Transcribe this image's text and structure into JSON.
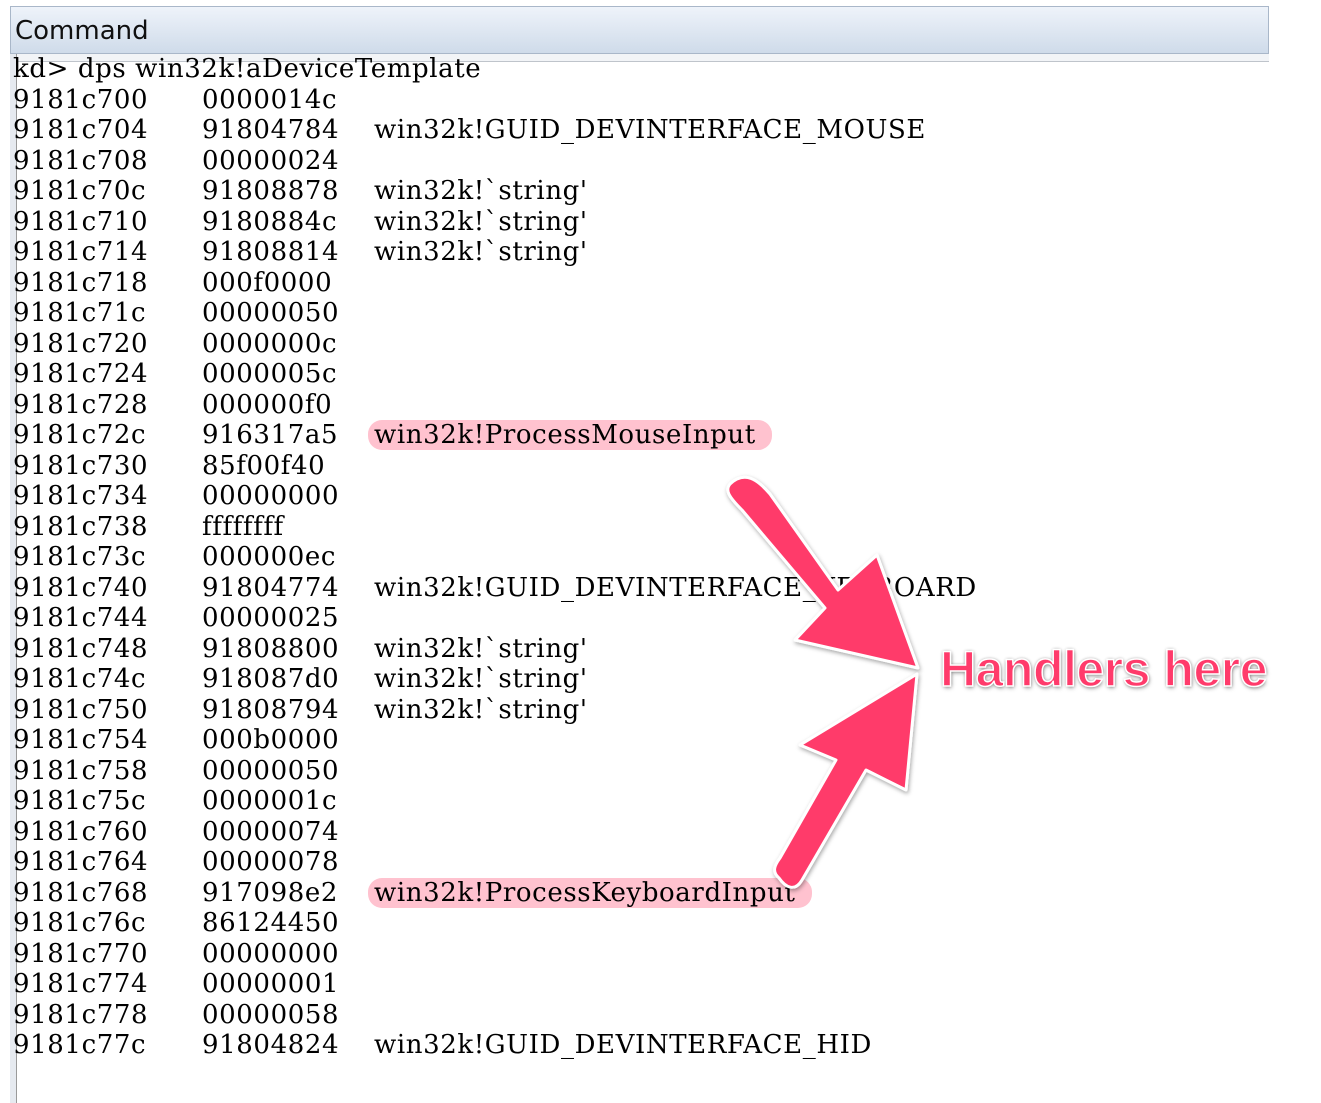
{
  "window": {
    "title": "Command"
  },
  "output": {
    "lines": [
      {
        "text": "kd> dps win32k!aDeviceTemplate"
      },
      {
        "addr": "9181c700",
        "val": "0000014c",
        "sym": ""
      },
      {
        "addr": "9181c704",
        "val": "91804784",
        "sym": "win32k!GUID_DEVINTERFACE_MOUSE"
      },
      {
        "addr": "9181c708",
        "val": "00000024",
        "sym": ""
      },
      {
        "addr": "9181c70c",
        "val": "91808878",
        "sym": "win32k!`string'"
      },
      {
        "addr": "9181c710",
        "val": "9180884c",
        "sym": "win32k!`string'"
      },
      {
        "addr": "9181c714",
        "val": "91808814",
        "sym": "win32k!`string'"
      },
      {
        "addr": "9181c718",
        "val": "000f0000",
        "sym": ""
      },
      {
        "addr": "9181c71c",
        "val": "00000050",
        "sym": ""
      },
      {
        "addr": "9181c720",
        "val": "0000000c",
        "sym": ""
      },
      {
        "addr": "9181c724",
        "val": "0000005c",
        "sym": ""
      },
      {
        "addr": "9181c728",
        "val": "000000f0",
        "sym": ""
      },
      {
        "addr": "9181c72c",
        "val": "916317a5",
        "sym": "win32k!ProcessMouseInput",
        "highlight": true
      },
      {
        "addr": "9181c730",
        "val": "85f00f40",
        "sym": ""
      },
      {
        "addr": "9181c734",
        "val": "00000000",
        "sym": ""
      },
      {
        "addr": "9181c738",
        "val": "ffffffff",
        "sym": ""
      },
      {
        "addr": "9181c73c",
        "val": "000000ec",
        "sym": ""
      },
      {
        "addr": "9181c740",
        "val": "91804774",
        "sym": "win32k!GUID_DEVINTERFACE_KEYBOARD"
      },
      {
        "addr": "9181c744",
        "val": "00000025",
        "sym": ""
      },
      {
        "addr": "9181c748",
        "val": "91808800",
        "sym": "win32k!`string'"
      },
      {
        "addr": "9181c74c",
        "val": "918087d0",
        "sym": "win32k!`string'"
      },
      {
        "addr": "9181c750",
        "val": "91808794",
        "sym": "win32k!`string'"
      },
      {
        "addr": "9181c754",
        "val": "000b0000",
        "sym": ""
      },
      {
        "addr": "9181c758",
        "val": "00000050",
        "sym": ""
      },
      {
        "addr": "9181c75c",
        "val": "0000001c",
        "sym": ""
      },
      {
        "addr": "9181c760",
        "val": "00000074",
        "sym": ""
      },
      {
        "addr": "9181c764",
        "val": "00000078",
        "sym": ""
      },
      {
        "addr": "9181c768",
        "val": "917098e2",
        "sym": "win32k!ProcessKeyboardInput",
        "highlight": true
      },
      {
        "addr": "9181c76c",
        "val": "86124450",
        "sym": ""
      },
      {
        "addr": "9181c770",
        "val": "00000000",
        "sym": ""
      },
      {
        "addr": "9181c774",
        "val": "00000001",
        "sym": ""
      },
      {
        "addr": "9181c778",
        "val": "00000058",
        "sym": ""
      },
      {
        "addr": "9181c77c",
        "val": "91804824",
        "sym": "win32k!GUID_DEVINTERFACE_HID"
      }
    ]
  },
  "annotation": {
    "label": "Handlers here",
    "color": "#ff3b6b",
    "highlight_color": "#ffc2cf"
  }
}
